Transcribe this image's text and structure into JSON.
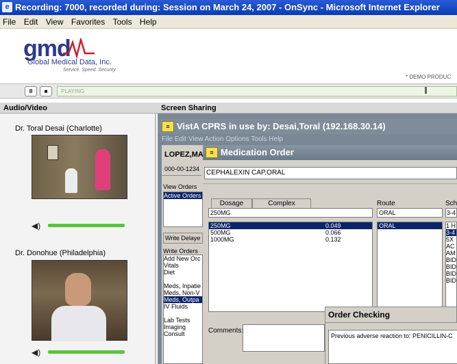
{
  "window": {
    "title": "Recording: 7000, recorded during: Session on March 24, 2007 - OnSync - Microsoft Internet Explorer",
    "icon": "ie-icon"
  },
  "menu": [
    "File",
    "Edit",
    "View",
    "Favorites",
    "Tools",
    "Help"
  ],
  "logo": {
    "brand": "gmd",
    "name": "Global Medical Data, Inc.",
    "tagline": "Service. Speed. Security."
  },
  "demo_label": "* DEMO PRODUC",
  "player": {
    "pause": "II",
    "stop": "■",
    "status": "PLAYING",
    "progress": 0.92
  },
  "sections": {
    "audio_video": "Audio/Video",
    "screen_sharing": "Screen Sharing"
  },
  "participants": [
    {
      "name": "Dr. Toral Desai (Charlotte)"
    },
    {
      "name": "Dr. Donohue (Philadelphia)"
    }
  ],
  "cprs": {
    "title": "VistA CPRS in use by: Desai,Toral  (192.168.30.14)",
    "menu": "File  Edit  View  Action  Options  Tools  Help",
    "patient_name": "LOPEZ,MA",
    "patient_id": "000-00-1234",
    "view_orders": "View Orders",
    "active_orders": "Active Orders",
    "write_delayed": "Write Delaye",
    "write_orders_header": "Write Orders",
    "write_orders": [
      "Add New Orc",
      "Vitals",
      "Diet",
      "",
      "Meds, Inpatie",
      "Meds, Non-V",
      "Meds, Outpa",
      "IV Fluids",
      "",
      "Lab Tests",
      "Imaging",
      "Consult"
    ],
    "selected_write_order": 6
  },
  "med_order": {
    "title": "Medication Order",
    "drug": "CEPHALEXIN CAP,ORAL",
    "tab_dosage": "Dosage",
    "tab_complex": "Complex",
    "route_label": "Route",
    "schedule_label": "Sch",
    "dosage_value": "250MG",
    "route_value": "ORAL",
    "schedule_value": "3-4",
    "dosages": [
      {
        "dose": "250MG",
        "price": "0.049"
      },
      {
        "dose": "500MG",
        "price": "0.066"
      },
      {
        "dose": "1000MG",
        "price": "0.132"
      }
    ],
    "routes": [
      "ORAL"
    ],
    "schedules": [
      "1 H",
      "3-4",
      "5X",
      "AC",
      "AM",
      "BID",
      "BID",
      "BID",
      "BID"
    ],
    "comments_label": "Comments:"
  },
  "order_check": {
    "title": "Order Checking",
    "message": "Previous adverse reaction to: PENICILLIN-C"
  }
}
